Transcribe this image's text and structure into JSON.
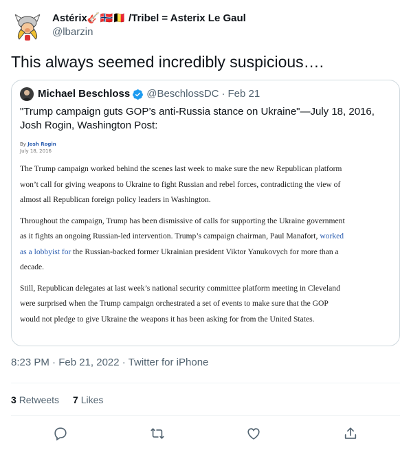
{
  "author": {
    "display_name": "Astérix🎸🇳🇴🇧🇪 /Tribel = Asterix Le Gaul",
    "handle": "@lbarzin"
  },
  "tweet_text": "This always seemed incredibly suspicious….",
  "quote": {
    "name": "Michael Beschloss",
    "handle": "@BeschlossDC",
    "separator": "·",
    "date": "Feb 21",
    "text": "\"Trump campaign guts GOP’s anti-Russia stance on Ukraine\"—July 18, 2016, Josh Rogin, Washington Post:",
    "article": {
      "by": "By",
      "author": "Josh Rogin",
      "date": "July 18, 2016",
      "p1": [
        "The Trump campaign worked behind the scenes last week to make sure the new Republican platform",
        "won’t call for giving weapons to Ukraine to fight Russian and rebel forces, contradicting the view of",
        "almost all Republican foreign policy leaders in Washington."
      ],
      "p2_line1": "Throughout the campaign, Trump has been dismissive of calls for supporting the Ukraine government",
      "p2_line2a": "as it fights an ongoing Russian-led intervention. Trump’s campaign chairman, Paul Manafort, ",
      "p2_link1": "worked",
      "p2_link2": "as a lobbyist for",
      "p2_line3b": " the Russian-backed former Ukrainian president Viktor Yanukovych for more than a",
      "p2_line4": "decade.",
      "p3": [
        "Still, Republican delegates at last week’s national security committee platform meeting in Cleveland",
        "were surprised when the Trump campaign orchestrated a set of events to make sure that the GOP",
        "would not pledge to give Ukraine the weapons it has been asking for from the United States."
      ]
    }
  },
  "timestamp": "8:23 PM · Feb 21, 2022 · Twitter for iPhone",
  "stats": {
    "retweets_count": "3",
    "retweets_label": "Retweets",
    "likes_count": "7",
    "likes_label": "Likes"
  },
  "colors": {
    "accent": "#1d9bf0",
    "secondary_text": "#536471",
    "border": "#cfd9de"
  },
  "icons": [
    "reply-icon",
    "retweet-icon",
    "like-icon",
    "share-icon",
    "verified-icon"
  ]
}
